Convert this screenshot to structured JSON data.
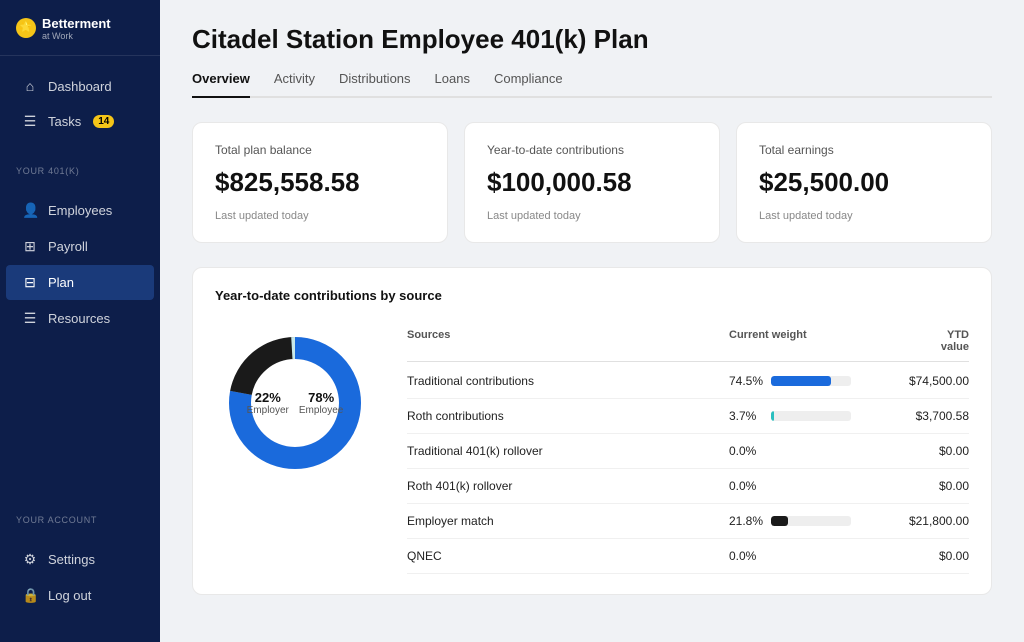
{
  "logo": {
    "brand": "Betterment",
    "sub": "at Work",
    "icon": "🌟"
  },
  "sidebar": {
    "main_items": [
      {
        "id": "dashboard",
        "label": "Dashboard",
        "icon": "⌂",
        "active": false
      },
      {
        "id": "tasks",
        "label": "Tasks",
        "icon": "☰",
        "active": false,
        "badge": "14"
      }
    ],
    "section401k_label": "YOUR 401(K)",
    "section401k_items": [
      {
        "id": "employees",
        "label": "Employees",
        "icon": "👤",
        "active": false
      },
      {
        "id": "payroll",
        "label": "Payroll",
        "icon": "⊞",
        "active": false
      },
      {
        "id": "plan",
        "label": "Plan",
        "icon": "⊟",
        "active": true
      },
      {
        "id": "resources",
        "label": "Resources",
        "icon": "☰",
        "active": false
      }
    ],
    "section_account_label": "YOUR ACCOUNT",
    "section_account_items": [
      {
        "id": "settings",
        "label": "Settings",
        "icon": "⚙",
        "active": false
      },
      {
        "id": "logout",
        "label": "Log out",
        "icon": "🔒",
        "active": false
      }
    ]
  },
  "header": {
    "title": "Citadel Station Employee 401(k) Plan"
  },
  "tabs": [
    {
      "id": "overview",
      "label": "Overview",
      "active": true
    },
    {
      "id": "activity",
      "label": "Activity",
      "active": false
    },
    {
      "id": "distributions",
      "label": "Distributions",
      "active": false
    },
    {
      "id": "loans",
      "label": "Loans",
      "active": false
    },
    {
      "id": "compliance",
      "label": "Compliance",
      "active": false
    }
  ],
  "stats": [
    {
      "label": "Total plan balance",
      "value": "$825,558.58",
      "updated": "Last updated today"
    },
    {
      "label": "Year-to-date contributions",
      "value": "$100,000.58",
      "updated": "Last updated today"
    },
    {
      "label": "Total earnings",
      "value": "$25,500.00",
      "updated": "Last updated today"
    }
  ],
  "contributions": {
    "section_title": "Year-to-date contributions by source",
    "donut": {
      "employer_pct": "22%",
      "employer_label": "Employer",
      "employee_pct": "78%",
      "employee_label": "Employee"
    },
    "table": {
      "headers": [
        "Sources",
        "Current weight",
        "YTD value"
      ],
      "rows": [
        {
          "name": "Traditional contributions",
          "weight": "74.5%",
          "bar_pct": 74.5,
          "bar_color": "blue",
          "value": "$74,500.00"
        },
        {
          "name": "Roth contributions",
          "weight": "3.7%",
          "bar_pct": 3.7,
          "bar_color": "teal",
          "value": "$3,700.58"
        },
        {
          "name": "Traditional 401(k) rollover",
          "weight": "0.0%",
          "bar_pct": 0,
          "bar_color": "none",
          "value": "$0.00"
        },
        {
          "name": "Roth 401(k) rollover",
          "weight": "0.0%",
          "bar_pct": 0,
          "bar_color": "none",
          "value": "$0.00"
        },
        {
          "name": "Employer match",
          "weight": "21.8%",
          "bar_pct": 21.8,
          "bar_color": "black",
          "value": "$21,800.00"
        },
        {
          "name": "QNEC",
          "weight": "0.0%",
          "bar_pct": 0,
          "bar_color": "none",
          "value": "$0.00"
        }
      ]
    }
  }
}
